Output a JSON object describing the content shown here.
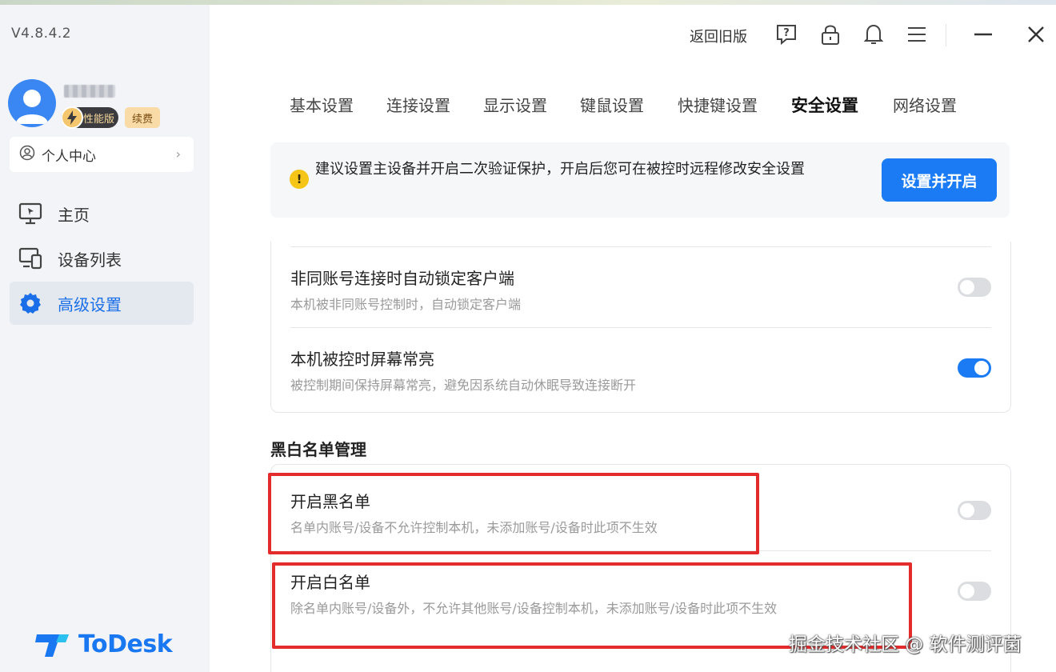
{
  "app": {
    "version": "V4.8.4.2",
    "brand": "ToDesk",
    "accent_color": "#1a7bf5"
  },
  "user": {
    "badge_perf": "性能版",
    "badge_renew": "续费",
    "personal_center": "个人中心"
  },
  "sidebar": {
    "items": [
      {
        "label": "主页",
        "icon": "monitor-icon"
      },
      {
        "label": "设备列表",
        "icon": "devices-icon"
      },
      {
        "label": "高级设置",
        "icon": "gear-icon"
      }
    ]
  },
  "titlebar": {
    "legacy_label": "返回旧版",
    "icons": [
      "help-icon",
      "lock-icon",
      "bell-icon",
      "menu-icon",
      "minimize-icon",
      "close-icon"
    ]
  },
  "tabs": [
    "基本设置",
    "连接设置",
    "显示设置",
    "键鼠设置",
    "快捷键设置",
    "安全设置",
    "网络设置"
  ],
  "active_tab": "安全设置",
  "notice": {
    "text": "建议设置主设备并开启二次验证保护，开启后您可在被控时远程修改安全设置",
    "button": "设置并开启"
  },
  "settings": [
    {
      "title": "非同账号连接时自动锁定客户端",
      "desc": "本机被非同账号控制时，自动锁定客户端",
      "on": false
    },
    {
      "title": "本机被控时屏幕常亮",
      "desc": "被控制期间保持屏幕常亮，避免因系统自动休眠导致连接断开",
      "on": true
    }
  ],
  "blacklist_section": {
    "title": "黑白名单管理",
    "items": [
      {
        "title": "开启黑名单",
        "desc": "名单内账号/设备不允许控制本机，未添加账号/设备时此项不生效",
        "on": false
      },
      {
        "title": "开启白名单",
        "desc": "除名单内账号/设备外，不允许其他账号/设备控制本机，未添加账号/设备时此项不生效",
        "on": false
      }
    ]
  },
  "watermark": "掘金技术社区 @ 软件测评菌"
}
